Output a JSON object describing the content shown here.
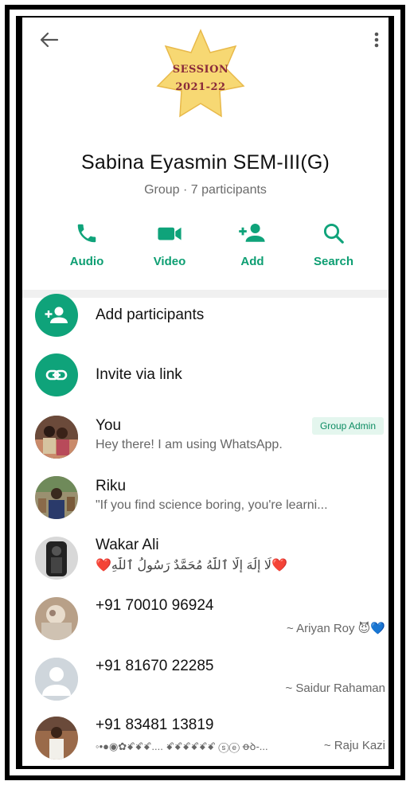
{
  "header": {
    "session_line1": "SESSION",
    "session_line2": "2021-22"
  },
  "group": {
    "name": "Sabina Eyasmin SEM-III(G)",
    "subtitle": "Group · 7 participants"
  },
  "actions": [
    {
      "label": "Audio",
      "icon": "phone-icon"
    },
    {
      "label": "Video",
      "icon": "video-camera-icon"
    },
    {
      "label": "Add",
      "icon": "add-person-icon"
    },
    {
      "label": "Search",
      "icon": "search-icon"
    }
  ],
  "menu": {
    "add_participants": "Add participants",
    "invite_link": "Invite via link"
  },
  "participants": [
    {
      "name": "You",
      "status": "Hey there! I am using WhatsApp.",
      "badge": "Group Admin"
    },
    {
      "name": "Riku",
      "status": "\"If you find science boring, you're learni..."
    },
    {
      "name": "Wakar Ali",
      "status": "❤️لَا إِلَٰهَ إِلَّا ٱللَّٰهُ مُحَمَّدٌ رَسُولُ ٱللَّٰهِ❤️"
    },
    {
      "name": "+91 70010 96924",
      "pushname": "~ Ariyan Roy 😈💙"
    },
    {
      "name": "+91 81670 22285",
      "pushname": "~ Saidur Rahaman"
    },
    {
      "name": "+91 83481 13819",
      "status": "◦•●◉✿ꗄꗄꗄ.... ꗄꗄꗄꗄꗄꗄ ⓢⓔ ꝋꝺ-...",
      "pushname": "~ Raju Kazi"
    }
  ],
  "colors": {
    "accent": "#0fa37a",
    "accent_text": "#0d9e72",
    "badge_bg": "#e4f6ee"
  }
}
